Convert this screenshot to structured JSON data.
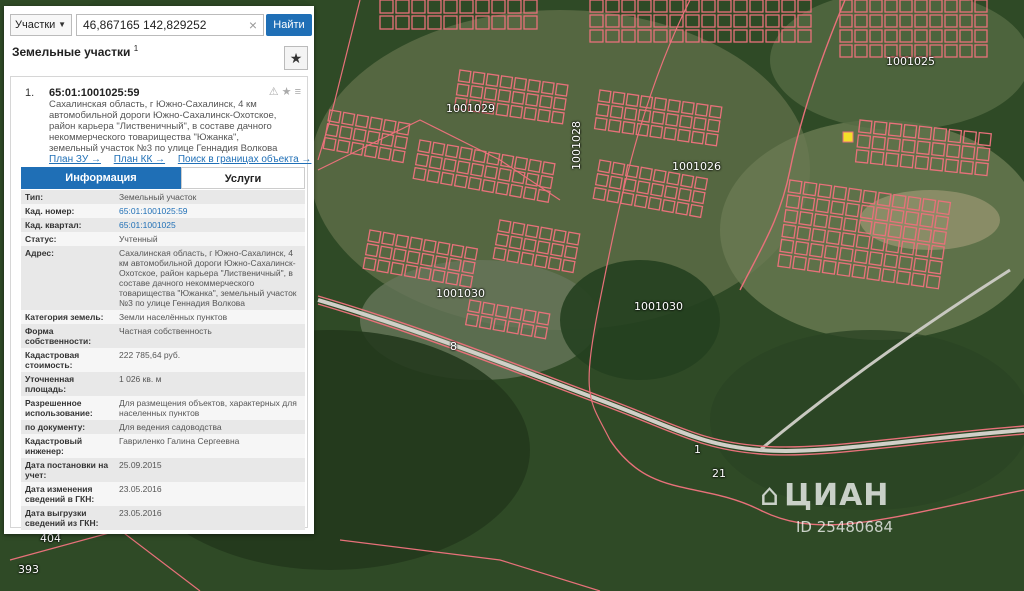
{
  "search": {
    "mode": "Участки",
    "query": "46,867165 142,829252",
    "button": "Найти"
  },
  "panel": {
    "title": "Земельные участки",
    "title_sup": "1",
    "result": {
      "number": "1.",
      "id": "65:01:1001025:59",
      "address": "Сахалинская область, г Южно-Сахалинск, 4 км автомобильной дороги Южно-Сахалинск-Охотское, район карьера \"Лиственичный\", в составе дачного некоммерческого товарищества \"Южанка\", земельный участок №3 по улице Геннадия Волкова",
      "links": [
        "План ЗУ →",
        "План КК →",
        "Поиск в границах объекта →"
      ]
    },
    "tabs": [
      "Информация",
      "Услуги"
    ],
    "rows": [
      {
        "k": "Тип:",
        "v": "Земельный участок"
      },
      {
        "k": "Кад. номер:",
        "v": "65:01:1001025:59"
      },
      {
        "k": "Кад. квартал:",
        "v": "65:01:1001025"
      },
      {
        "k": "Статус:",
        "v": "Учтенный"
      },
      {
        "k": "Адрес:",
        "v": "Сахалинская область, г Южно-Сахалинск, 4 км автомобильной дороги Южно-Сахалинск-Охотское, район карьера \"Лиственичный\", в составе дачного некоммерческого товарищества \"Южанка\", земельный участок №3 по улице Геннадия Волкова"
      },
      {
        "k": "Категория земель:",
        "v": "Земли населённых пунктов"
      },
      {
        "k": "Форма собственности:",
        "v": "Частная собственность"
      },
      {
        "k": "Кадастровая стоимость:",
        "v": "222 785,64 руб."
      },
      {
        "k": "Уточненная площадь:",
        "v": "1 026 кв. м"
      },
      {
        "k": "Разрешенное использование:",
        "v": "Для размещения объектов, характерных для населенных пунктов"
      },
      {
        "k": "по документу:",
        "v": "Для ведения садоводства"
      },
      {
        "k": "Кадастровый инженер:",
        "v": "Гавриленко Галина Сергеевна"
      },
      {
        "k": "Дата постановки на учет:",
        "v": "25.09.2015"
      },
      {
        "k": "Дата изменения сведений в ГКН:",
        "v": "23.05.2016"
      },
      {
        "k": "Дата выгрузки сведений из ГКН:",
        "v": "23.05.2016"
      }
    ]
  },
  "map": {
    "quarters": [
      "1001025",
      "1001029",
      "1001028",
      "1001026",
      "1001030",
      "1001030"
    ],
    "road_labels": [
      "8",
      "1",
      "21",
      "404",
      "393"
    ],
    "watermark": {
      "brand": "ЦИАН",
      "id": "ID 25480684"
    },
    "colors": {
      "boundary": "#e8717a",
      "forest": "#2c4a23",
      "clearing": "#8a9a6a",
      "road": "#c9c9c2",
      "highlight": "#f2e02a"
    }
  }
}
